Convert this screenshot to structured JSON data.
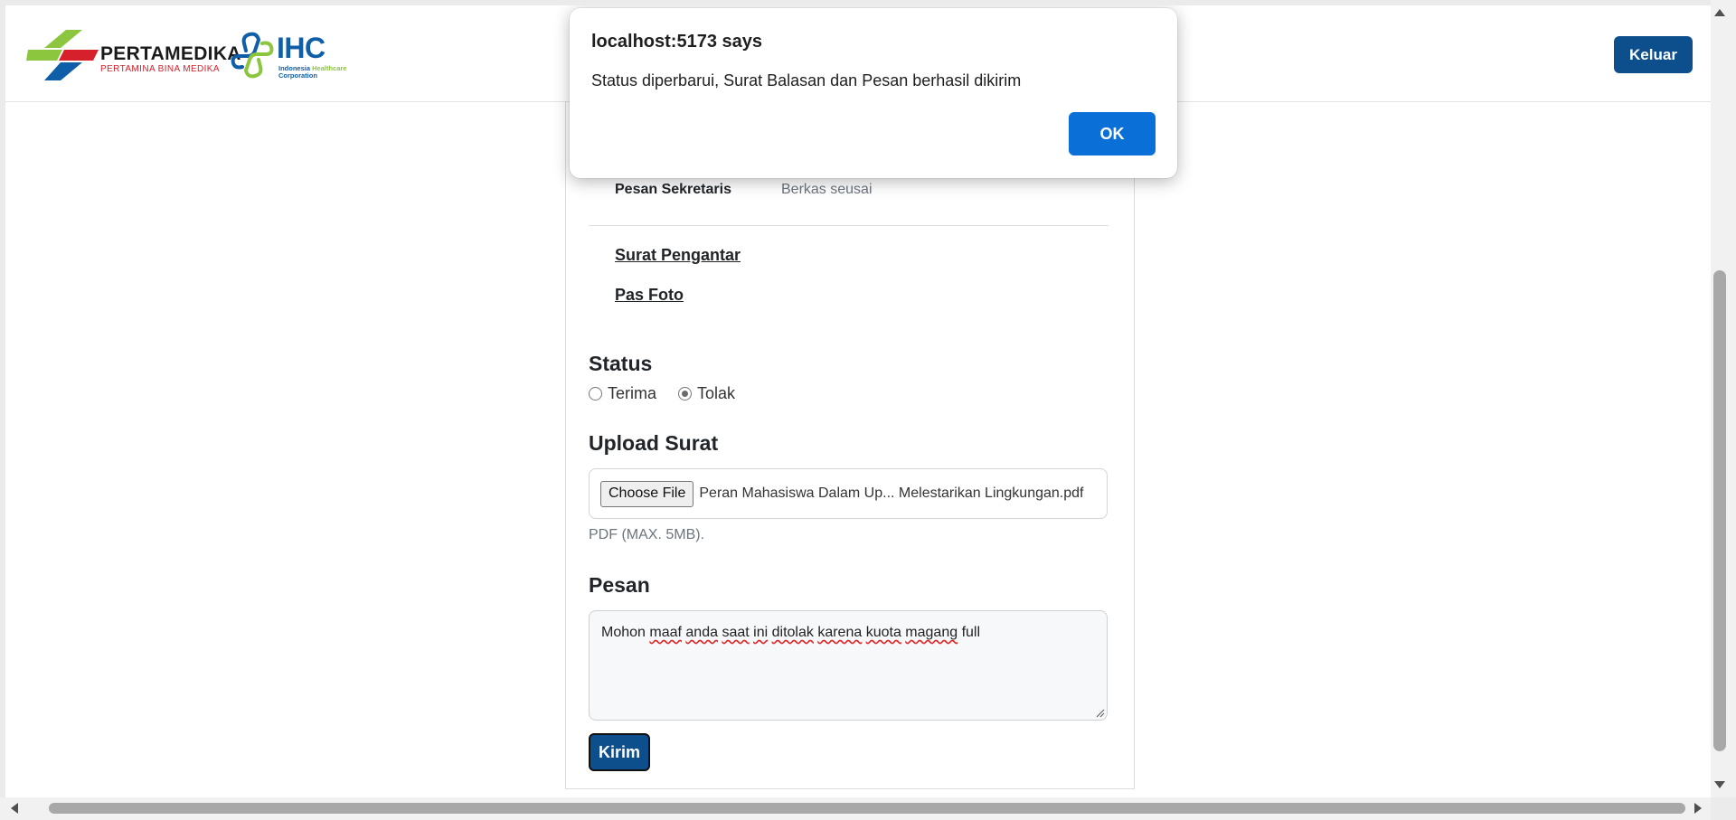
{
  "header": {
    "logo_pertamedika": {
      "name": "PERTAMEDIKA",
      "subtitle": "PERTAMINA BINA MEDIKA"
    },
    "logo_ihc": {
      "name": "IHC",
      "subtitle_line1": "Indonesia",
      "subtitle_highlight": "Healthcare",
      "subtitle_line2": "Corporation"
    },
    "logout_label": "Keluar"
  },
  "details": {
    "secretary_message_label": "Pesan Sekretaris",
    "secretary_message_value": "Berkas seusai",
    "documents": [
      "Surat Pengantar",
      "Pas Foto"
    ]
  },
  "status": {
    "title": "Status",
    "options": [
      {
        "label": "Terima",
        "checked": false
      },
      {
        "label": "Tolak",
        "checked": true
      }
    ]
  },
  "upload": {
    "title": "Upload Surat",
    "choose_label": "Choose File",
    "file_name": "Peran Mahasiswa Dalam Up... Melestarikan Lingkungan.pdf",
    "hint": "PDF (MAX. 5MB)."
  },
  "message": {
    "title": "Pesan",
    "value_words": [
      "Mohon",
      "maaf",
      "anda",
      "saat",
      "ini",
      "ditolak",
      "karena",
      "kuota",
      "magang",
      "full"
    ],
    "misspelled": [
      false,
      true,
      true,
      true,
      true,
      true,
      true,
      true,
      true,
      false
    ]
  },
  "submit_label": "Kirim",
  "alert": {
    "title": "localhost:5173 says",
    "message": "Status diperbarui, Surat Balasan dan Pesan berhasil dikirim",
    "ok_label": "OK"
  },
  "colors": {
    "primary": "#0d4e8c",
    "dialog_button": "#0b6fd8",
    "muted_text": "#6c757d",
    "pertamedika_red": "#d6202c",
    "ihc_blue": "#0f5ea8",
    "ihc_green": "#8cc63f"
  }
}
